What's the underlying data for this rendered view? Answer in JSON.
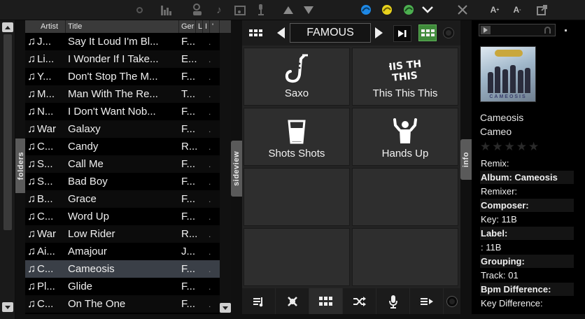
{
  "toolbar": {
    "icons": [
      "record-dot-icon",
      "equalizer-icon",
      "dj-icon",
      "music-note-icon",
      "folder-music-icon",
      "microphone-stand-icon",
      "arrow-up-icon",
      "arrow-down-icon",
      "broadcast-blue-icon",
      "broadcast-yellow-icon",
      "broadcast-green-icon",
      "chevron-down-icon",
      "expand-icon",
      "font-size-up-icon",
      "font-size-down-icon",
      "popout-icon"
    ],
    "font_up": "A",
    "font_down": "A"
  },
  "sidebar": {
    "folders_label": "folders",
    "sideview_label": "sideview",
    "info_label": "info"
  },
  "tracklist": {
    "columns": [
      "Artist",
      "Title",
      "Ger",
      "L",
      "I",
      "'"
    ],
    "rows": [
      {
        "artist": "J...",
        "title": "Say It Loud I'm Bl...",
        "genre": "F...",
        "extra": "."
      },
      {
        "artist": "Li...",
        "title": "I Wonder If I Take...",
        "genre": "E...",
        "extra": "."
      },
      {
        "artist": "Y...",
        "title": "Don't Stop The M...",
        "genre": "F...",
        "extra": "."
      },
      {
        "artist": "M...",
        "title": "Man With The Re...",
        "genre": "T...",
        "extra": "."
      },
      {
        "artist": "N...",
        "title": "I Don't Want Nob...",
        "genre": "F...",
        "extra": "."
      },
      {
        "artist": "War",
        "title": "Galaxy",
        "genre": "F...",
        "extra": "."
      },
      {
        "artist": "C...",
        "title": "Candy",
        "genre": "R...",
        "extra": "."
      },
      {
        "artist": "S...",
        "title": "Call Me",
        "genre": "F...",
        "extra": "."
      },
      {
        "artist": "S...",
        "title": "Bad Boy",
        "genre": "F...",
        "extra": "."
      },
      {
        "artist": "B...",
        "title": "Grace",
        "genre": "F...",
        "extra": "."
      },
      {
        "artist": "C...",
        "title": "Word Up",
        "genre": "F...",
        "extra": "."
      },
      {
        "artist": "War",
        "title": "Low Rider",
        "genre": "R...",
        "extra": "."
      },
      {
        "artist": "Ai...",
        "title": "Amajour",
        "genre": "J...",
        "extra": "."
      },
      {
        "artist": "C...",
        "title": "Cameosis",
        "genre": "F...",
        "extra": "."
      },
      {
        "artist": "Pl...",
        "title": "Glide",
        "genre": "F...",
        "extra": "."
      },
      {
        "artist": "C...",
        "title": "On The One",
        "genre": "F...",
        "extra": "."
      }
    ],
    "selected_index": 13
  },
  "sampler": {
    "bank_name": "FAMOUS",
    "pads": [
      {
        "label": "Saxo",
        "icon": "saxophone-icon"
      },
      {
        "label": "This This This",
        "icon": "this-this-text-icon",
        "icon_text": "THIS THIS"
      },
      {
        "label": "Shots Shots",
        "icon": "shot-glass-icon"
      },
      {
        "label": "Hands Up",
        "icon": "hands-up-icon"
      },
      {
        "label": ""
      },
      {
        "label": ""
      },
      {
        "label": ""
      },
      {
        "label": ""
      }
    ],
    "bottom_buttons": [
      "playlist-icon",
      "automix-icon",
      "sampler-grid-icon",
      "shuffle-icon",
      "microphone-icon",
      "add-to-list-icon",
      "record-icon"
    ],
    "active_bottom": 2
  },
  "info_panel": {
    "album_cover_text": "CAMEOSIS",
    "title": "Cameosis",
    "artist": "Cameo",
    "fields": [
      {
        "text": "Remix:",
        "bold": false
      },
      {
        "text": "Album: Cameosis",
        "bold": true
      },
      {
        "text": "Remixer:",
        "bold": false
      },
      {
        "text": "Composer:",
        "bold": true
      },
      {
        "text": "Key: 11B",
        "bold": false
      },
      {
        "text": "Label:",
        "bold": true
      },
      {
        "text": ": 11B",
        "bold": false
      },
      {
        "text": "Grouping:",
        "bold": true
      },
      {
        "text": "Track: 01",
        "bold": false
      },
      {
        "text": "Bpm Difference:",
        "bold": true
      },
      {
        "text": "Key Difference:",
        "bold": false
      }
    ],
    "rating": 0
  },
  "colors": {
    "accent_green": "#3f8a3a",
    "selected_row": "#3a3f47",
    "broadcast_blue": "#1e88e5",
    "broadcast_yellow": "#e8d21d",
    "broadcast_green": "#4caf50"
  }
}
